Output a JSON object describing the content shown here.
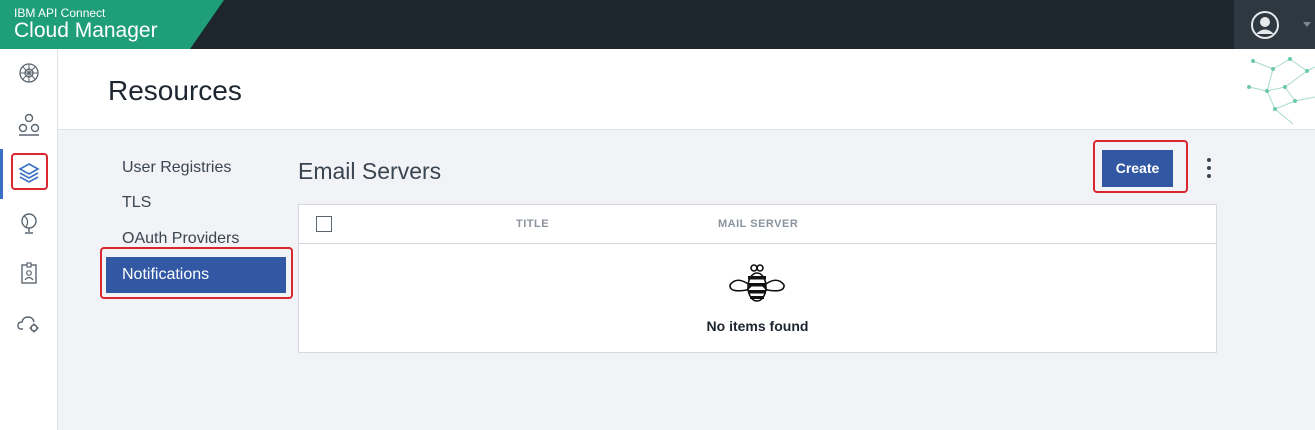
{
  "header": {
    "product_small": "IBM API Connect",
    "product_large": "Cloud Manager"
  },
  "page": {
    "title": "Resources"
  },
  "resource_nav": {
    "items": [
      {
        "label": "User Registries"
      },
      {
        "label": "TLS"
      },
      {
        "label": "OAuth Providers"
      },
      {
        "label": "Notifications"
      }
    ]
  },
  "section": {
    "title": "Email Servers",
    "create_label": "Create"
  },
  "table": {
    "columns": [
      "TITLE",
      "MAIL SERVER"
    ],
    "empty_text": "No items found"
  },
  "colors": {
    "brand_green": "#1f9e7a",
    "accent_blue": "#3258a4",
    "highlight_red": "#d9262f"
  }
}
